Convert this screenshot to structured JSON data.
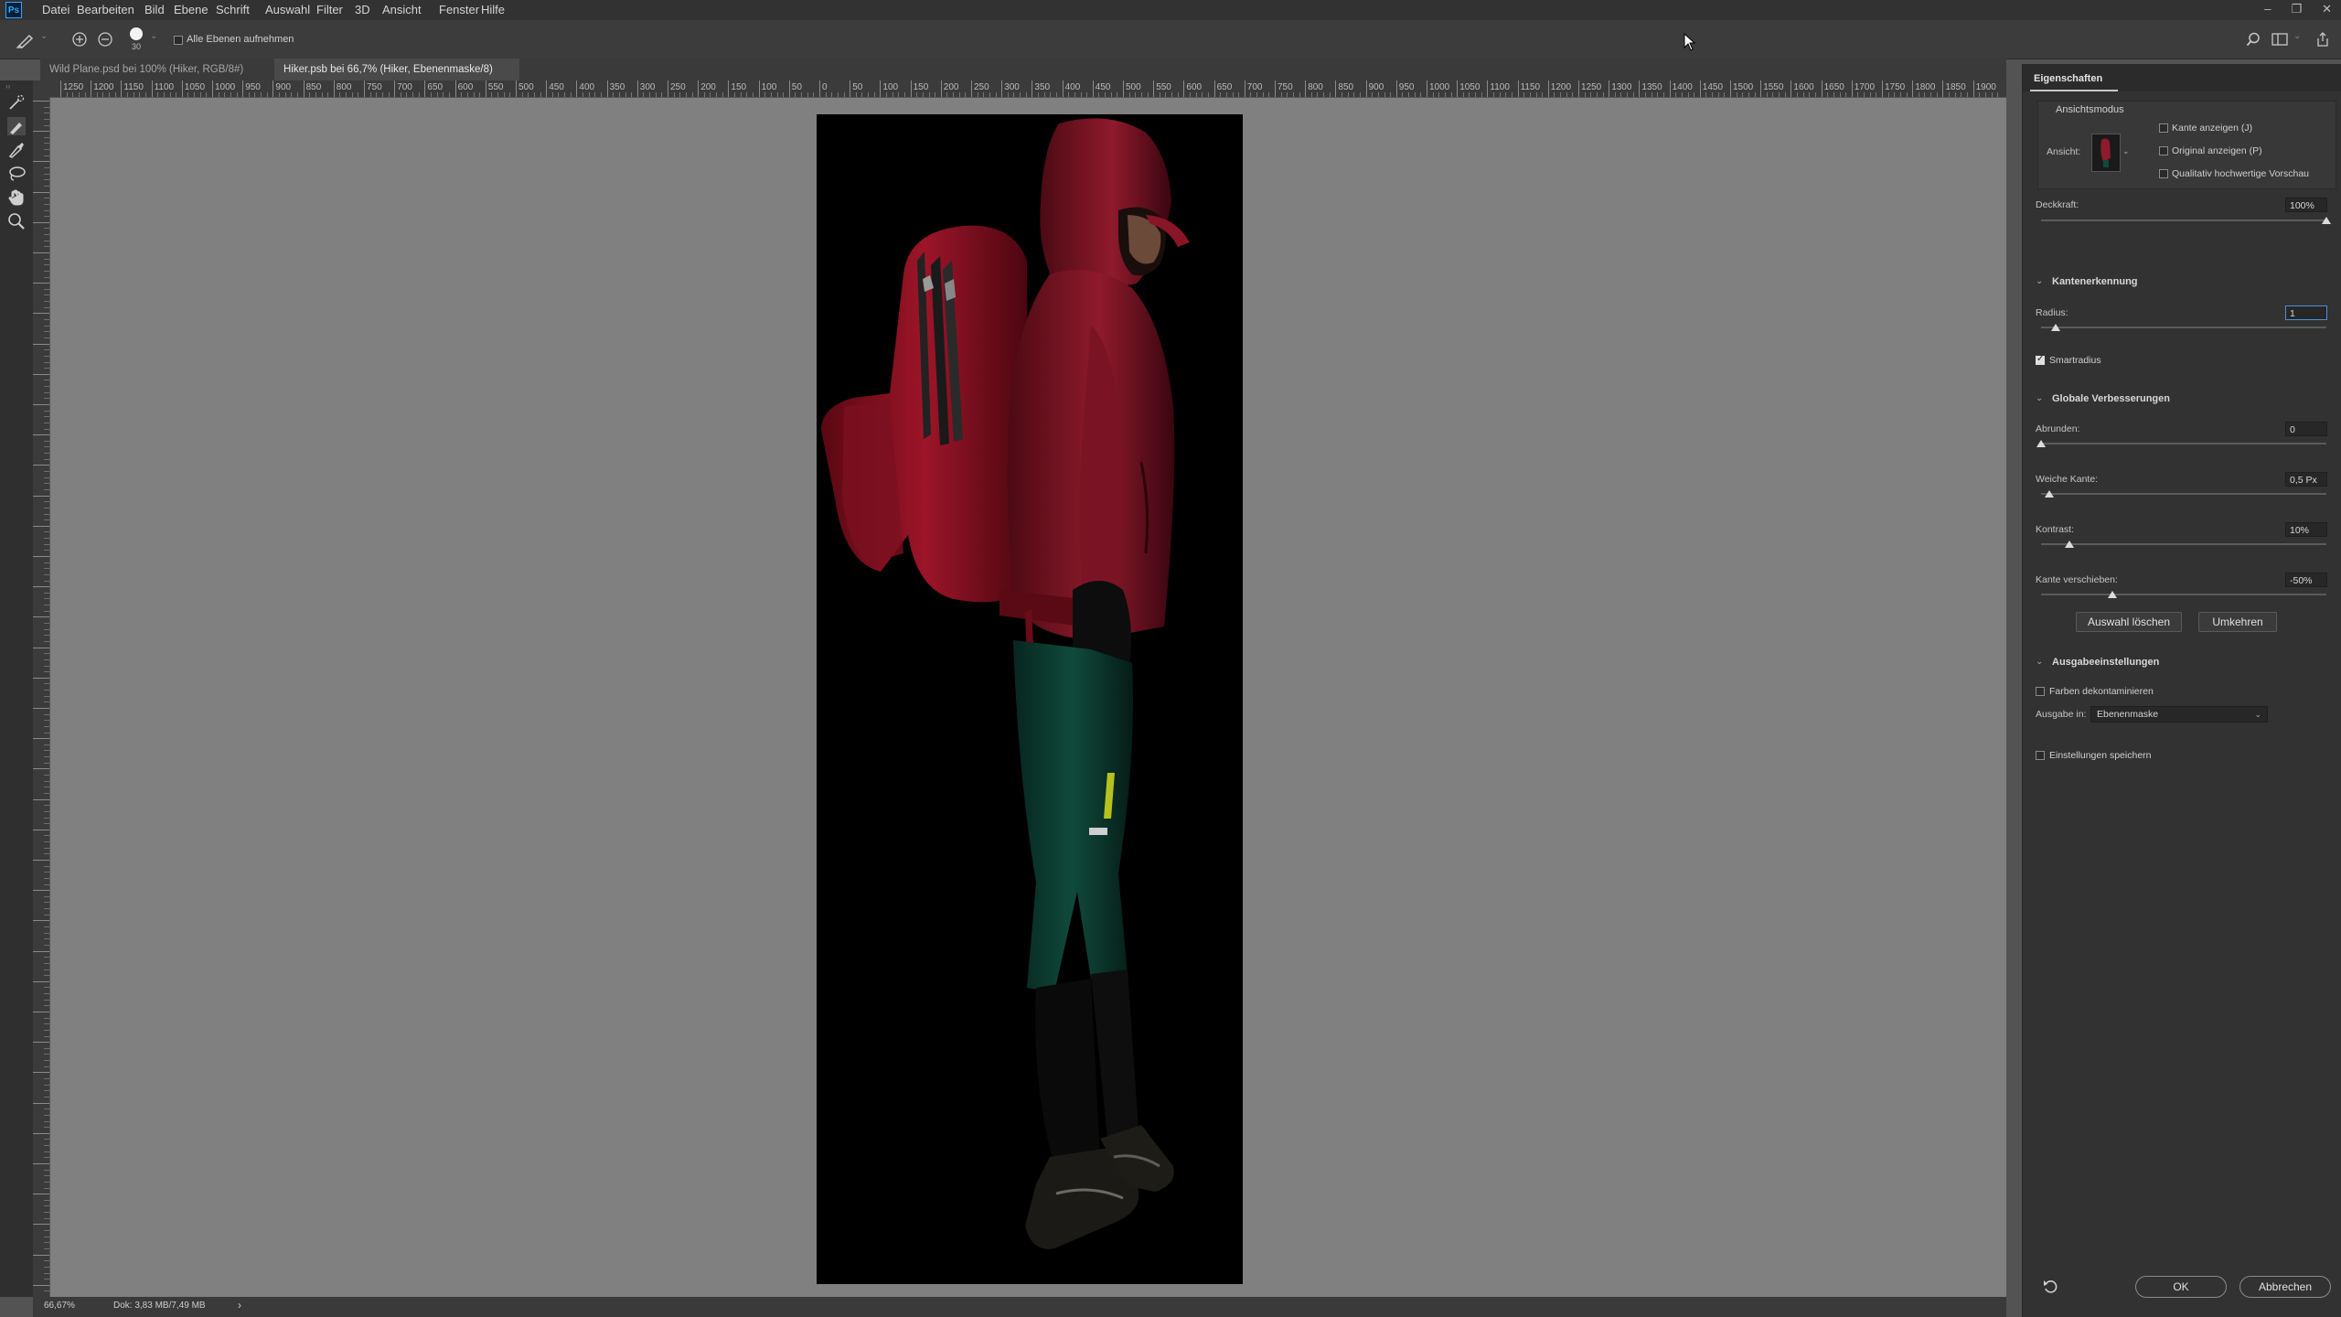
{
  "menu": {
    "logo": "Ps",
    "items": [
      "Datei",
      "Bearbeiten",
      "Bild",
      "Ebene",
      "Schrift",
      "Auswahl",
      "Filter",
      "3D",
      "Ansicht",
      "Fenster",
      "Hilfe"
    ]
  },
  "options": {
    "brush_size": "30",
    "sample_all_layers_label": "Alle Ebenen aufnehmen"
  },
  "tabs": [
    {
      "label": "Wild Plane.psd bei 100% (Hiker, RGB/8#) *",
      "close": "×"
    },
    {
      "label": "Hiker.psb bei 66,7% (Hiker, Ebenenmaske/8) *",
      "close": "×"
    }
  ],
  "ruler": {
    "h_labels": [
      "1250",
      "1200",
      "1150",
      "1100",
      "1050",
      "1000",
      "950",
      "900",
      "850",
      "800",
      "750",
      "700",
      "650",
      "600",
      "550",
      "500",
      "450",
      "400",
      "350",
      "300",
      "250",
      "200",
      "150",
      "100",
      "50",
      "0",
      "50",
      "100",
      "150",
      "200",
      "250",
      "300",
      "350",
      "400",
      "450",
      "500",
      "550",
      "600",
      "650",
      "700",
      "750",
      "800",
      "850",
      "900",
      "950",
      "1000",
      "1050",
      "1100",
      "1150",
      "1200",
      "1250",
      "1300",
      "1350",
      "1400",
      "1450",
      "1500",
      "1550",
      "1600",
      "1650",
      "1700",
      "1750",
      "1800",
      "1850",
      "1900"
    ]
  },
  "status": {
    "zoom": "66,67%",
    "doc": "Dok: 3,83 MB/7,49 MB",
    "arrow": "›"
  },
  "panel": {
    "title": "Eigenschaften",
    "view_mode": {
      "header": "Ansichtsmodus",
      "view_label": "Ansicht:",
      "show_edge": "Kante anzeigen (J)",
      "show_original": "Original anzeigen (P)",
      "hq_preview": "Qualitativ hochwertige Vorschau"
    },
    "opacity": {
      "label": "Deckkraft:",
      "value": "100%",
      "level": 1.0
    },
    "edge_detection": {
      "header": "Kantenerkennung",
      "radius_label": "Radius:",
      "radius_value": "1",
      "radius_level": 0.05,
      "smart_radius_label": "Smartradius",
      "smart_radius_checked": true
    },
    "global_refinements": {
      "header": "Globale Verbesserungen",
      "smooth_label": "Abrunden:",
      "smooth_value": "0",
      "smooth_level": 0.0,
      "feather_label": "Weiche Kante:",
      "feather_value": "0,5 Px",
      "feather_level": 0.03,
      "contrast_label": "Kontrast:",
      "contrast_value": "10%",
      "contrast_level": 0.1,
      "shift_label": "Kante verschieben:",
      "shift_value": "-50%",
      "shift_level": 0.25,
      "clear_button": "Auswahl löschen",
      "invert_button": "Umkehren"
    },
    "output": {
      "header": "Ausgabeeinstellungen",
      "decontaminate_label": "Farben dekontaminieren",
      "output_to_label": "Ausgabe in:",
      "output_to_value": "Ebenenmaske",
      "remember_label": "Einstellungen speichern"
    },
    "ok": "OK",
    "cancel": "Abbrechen"
  }
}
